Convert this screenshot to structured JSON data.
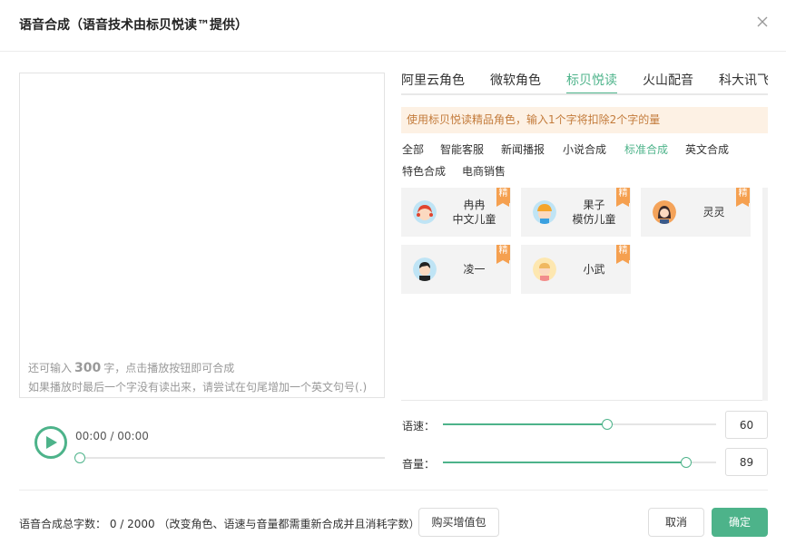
{
  "dialog": {
    "title": "语音合成（语音技术由标贝悦读™提供）"
  },
  "editor": {
    "text": "",
    "hint_prefix": "还可输入",
    "remaining": "300",
    "hint_suffix": "字，点击播放按钮即可合成",
    "hint_line2": "如果播放时最后一个字没有读出来，请尝试在句尾增加一个英文句号(.)"
  },
  "player": {
    "time": "00:00 / 00:00",
    "progress": 0
  },
  "tabs": [
    {
      "label": "阿里云角色",
      "active": false
    },
    {
      "label": "微软角色",
      "active": false
    },
    {
      "label": "标贝悦读",
      "active": true
    },
    {
      "label": "火山配音",
      "active": false
    },
    {
      "label": "科大讯飞",
      "active": false
    }
  ],
  "notice": "使用标贝悦读精品角色，输入1个字将扣除2个字的量",
  "categories": [
    {
      "label": "全部",
      "active": false
    },
    {
      "label": "智能客服",
      "active": false
    },
    {
      "label": "新闻播报",
      "active": false
    },
    {
      "label": "小说合成",
      "active": false
    },
    {
      "label": "标准合成",
      "active": true
    },
    {
      "label": "英文合成",
      "active": false
    },
    {
      "label": "特色合成",
      "active": false
    },
    {
      "label": "电商销售",
      "active": false
    }
  ],
  "voices": [
    {
      "name": "冉冉",
      "sub": "中文儿童",
      "badge": "精"
    },
    {
      "name": "果子",
      "sub": "模仿儿童",
      "badge": "精"
    },
    {
      "name": "灵灵",
      "sub": "",
      "badge": "精"
    },
    {
      "name": "凌一",
      "sub": "",
      "badge": "精"
    },
    {
      "name": "小武",
      "sub": "",
      "badge": "精"
    }
  ],
  "speed": {
    "label": "语速：",
    "value": "60",
    "min": 0,
    "max": 100
  },
  "volume": {
    "label": "音量：",
    "value": "89",
    "min": 0,
    "max": 100
  },
  "footer": {
    "summary": "语音合成总字数：  0 / 2000  （改变角色、语速与音量都需重新合成并且消耗字数）",
    "buy_label": "购买增值包",
    "cancel_label": "取消",
    "confirm_label": "确定"
  },
  "colors": {
    "accent": "#4db38a",
    "badge": "#f5a050",
    "notice_bg": "#fdf1e4",
    "notice_text": "#c37b3b"
  }
}
